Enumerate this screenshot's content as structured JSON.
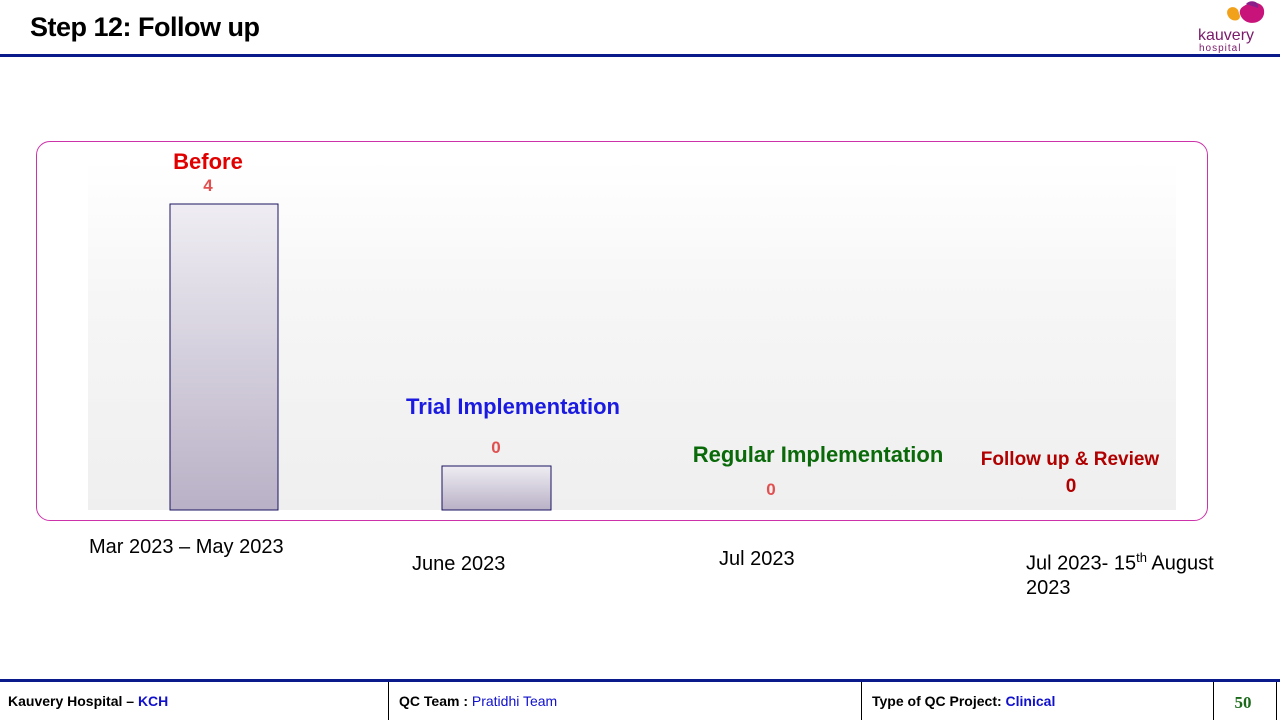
{
  "header": {
    "title": "Step 12: Follow up"
  },
  "logo": {
    "name": "kauvery",
    "sub": "hospital"
  },
  "chart_data": {
    "type": "bar",
    "categories": [
      "Mar 2023 – May 2023",
      "June 2023",
      "Jul 2023",
      "Jul 2023- 15th August 2023"
    ],
    "values": [
      4,
      0,
      0,
      0
    ],
    "data_labels": [
      "4",
      "0",
      "0",
      "0"
    ],
    "phase_labels": [
      "Before",
      "Trial Implementation",
      "Regular Implementation",
      "Follow up & Review"
    ],
    "phase_colors": [
      "#e00000",
      "#1a1ae0",
      "#0a6a0a",
      "#b00000"
    ],
    "data_label_colors": [
      "#e05050",
      "#e05050",
      "#e05050",
      "#b00000"
    ],
    "ylim": [
      0,
      4
    ],
    "grid": false,
    "legend": "none"
  },
  "categories_display": {
    "c1": "Mar 2023 – May 2023",
    "c2": "June 2023",
    "c3": "Jul 2023",
    "c4_pre": "Jul 2023- 15",
    "c4_sup": "th",
    "c4_post": " August",
    "c4_line2": "2023"
  },
  "footer": {
    "hospital_label": "Kauvery Hospital – ",
    "hospital_code": "KCH",
    "team_label": "QC Team : ",
    "team_value": "Pratidhi Team",
    "type_label": "Type of QC Project: ",
    "type_value": "Clinical",
    "page": "50"
  }
}
